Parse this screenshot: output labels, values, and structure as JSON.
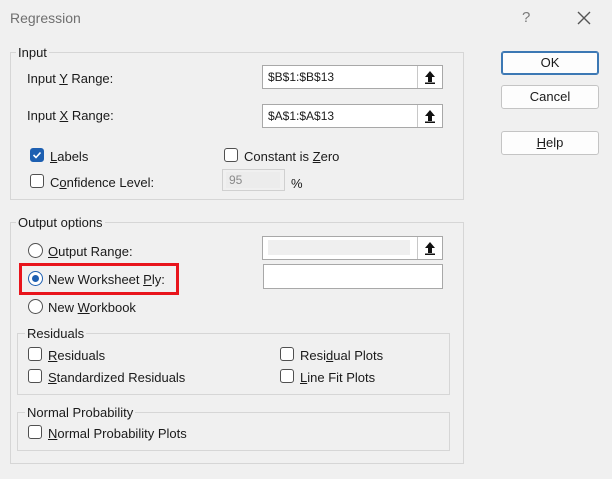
{
  "window": {
    "title": "Regression",
    "help_glyph": "?",
    "close_icon": "close-icon"
  },
  "buttons": {
    "ok": "OK",
    "cancel": "Cancel",
    "help": "Help"
  },
  "input": {
    "group_label": "Input",
    "y_range": {
      "label": "Input Y Range:",
      "value": "$B$1:$B$13"
    },
    "x_range": {
      "label": "Input X Range:",
      "value": "$A$1:$A$13"
    },
    "labels": {
      "label": "Labels",
      "checked": true
    },
    "constant_zero": {
      "label": "Constant is Zero",
      "checked": false
    },
    "confidence": {
      "label": "Confidence Level:",
      "checked": false,
      "value": "95",
      "unit": "%"
    }
  },
  "output": {
    "group_label": "Output options",
    "output_range": {
      "label": "Output Range:",
      "selected": false,
      "value": ""
    },
    "new_worksheet": {
      "label": "New Worksheet Ply:",
      "selected": true,
      "value": ""
    },
    "new_workbook": {
      "label": "New Workbook",
      "selected": false
    },
    "residuals": {
      "group_label": "Residuals",
      "residuals": "Residuals",
      "standardized": "Standardized Residuals",
      "residual_plots": "Residual Plots",
      "line_fit": "Line Fit Plots"
    },
    "normal_probability": {
      "group_label": "Normal Probability",
      "plots": "Normal Probability Plots"
    }
  },
  "colors": {
    "accent": "#1d5fb1",
    "highlight": "#e8141c",
    "background": "#f0f0f0"
  }
}
